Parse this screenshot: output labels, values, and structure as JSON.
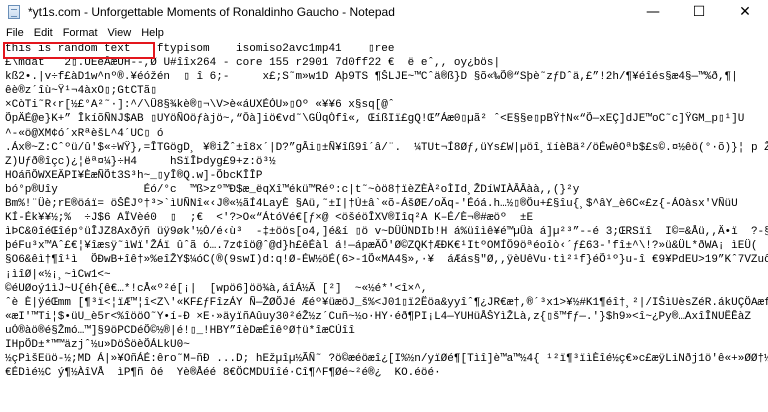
{
  "window": {
    "title": "*yt1s.com - Unforgettable Moments of Ronaldinho Gaucho - Notepad",
    "minimize_glyph": "—",
    "maximize_glyph": "☐",
    "close_glyph": "✕"
  },
  "menu": {
    "file": "File",
    "edit": "Edit",
    "format": "Format",
    "view": "View",
    "help": "Help"
  },
  "colors": {
    "highlight_box": "#e3161d"
  },
  "document": {
    "lines": [
      "this is random text    ftypisom    isomiso2avc1mp41    ▯ree",
      "£\\mdat   2▯.UEéÅæUH--,Ø U#îîx264 - core 155 r2901 7d0ff22 €  ë eˆ,, oy¿bös|",
      "kß2•.|v÷f£àD1w^nº®.¥éóžén  ▯ î 6;-     x£;S˜m»w1D Aþ9TS ¶ŠLJE~™Cˆä®ß}D §õ«‰Õ®“Sþè˜zƒDˆä,£”!2h/¶¥éîés§æ4§—™%ð,¶|",
      "êè®z´îù~Ÿ¹¬4àxO▯;GtCTã▯",
      "×CòTi˜R‹r[½£°A²˜·]:^/\\Û8§¾kè®▯¬\\V>è«áUXÉÓU»▯Oº «¥¥6 x§sq[@ˆ",
      "ÕpÄÉ@e}K+” ÎkíõÑNJ$AB ▯UYöÑOöƒàjö~,“Ôà]iö€vd˜\\GÜqÒfî«, ŒíßIï£gQ!Œ”Áæ0▯µã² ˆ<E§§e▯pBŸ†N«“Õ—xEÇ]dJE™oC˜c]ŸGM_p▯¹]U",
      "^-«ö@XM¢ó´xRªèšL^4´UC▯ ó",
      ".Áx®~Z:Cˆºü/û'$«÷WŸ},=ÎTGögD¸ ¥®iŽˆ±î8x´|D?”gÂi▯±Ñ¥îß9î´â/¨.  ¼TUt¬Í8Øƒ,üYs£W|µöî¸ïíèBä²/öÉwêOªb$£s©.¤½êö(°·õ)}¦ p Žéöè†®±é¹¿è¬1¦6KàØÿÿ]è>/",
      "Z)Uƒð®îçc)¿¦ëª¤¼}÷H4     hSïÎÞdyg£9+z:ö³½",
      "HOáñÔWXEÄPI¥ÈæÑÕt3S³h~_▯yÎ®Q.w]-ÕbcKÎÎP",
      "bó°p®Uîy             Éó/°c  ™ß>zº™Ð$æ_ëqXî™ékü™Réº:c|t˜~òö8†ïèZÈÀ²oÌId¸ŽDíWIÀÂÂàà,,(}²y",
      "Bm%!¨Üè;rE®öáï= öŠÊJº†³>`ìUÑNî«‹J®«½ãÍ4LayÈ §Aü,˜±I|†Ú±â`«õ-ÁšØE/oÄq-'Éóá.h…½▯®Öu+£§îu{¸$^âY_è6C«£z{-ÁOàsx'VÑüU",
      "KÍ-Ék¥¥½;%  ÷J$6 AÏVèé0  ▯  ;€  <'?>O«“ÁtóVé€[ƒ×@ <öšéöÎXV®Iîq²A K–É/È¬®#æöº  ±E",
      "ìÞC&0îéŒîép°üÎJZ8Axðýñ üÿ9øk'½Ò/é‹ù³  -‡±öös[o4,]é&í ▯ö v~DÜÜNDIb!H á%üîìê¥é™µÜà á]µ²³”--é 3;ŒRSïî  I©=&Åü,,Ä•ï  ?-§IèöÒy",
      "þéFu³x™Aˆ£€¦¥îæsÿ˜ìWï'ŽÁï ûˆã ó….7z¢îö@ˆ@d}h£êÉàl á!—ápæÄÕ'Ø©ZQK†ÆÐK€¹ItºOMÍÖ9öªéoîò‹´ƒ£63-'fî±^\\!?»ü&ÜL*ðWA¡ ìEÜ(  á",
      "§O6&êì†¶î¹ì  ÕÐwB+îê†»%eîŽY$¼óC(®(9swI)d:q!Ø-ÉW½öÉ(6>-1Õ«MA4§»,·¥  áÆás§\"Ø,,ÿèUêVu·tì²¹f}éÕ¹º}u-î €9¥PdEU>19”Kˆ7VZuô0Îî",
      "¡ìîØ|«½¡¸~ìCw1<~",
      "©éUØoý1ìJ~U{éh{ê€…*!cÅ«º²é[¡|  [wpö6]öö¾à,áîÁ½Ä [²]  ~«½é*'<î×^,",
      "ˆè È|ÿéŒmm [¶³ï<¦ïÆ™¦î<Z\\'«KF£ƒFîzÁY Ñ—ŽØÕJé Æéº¥üæöJ_š%<J01▯ï2Ëöa&yyîˆ¶¿JR€æ†,®´­³x1>¥½#K1¶éî†¸²|/IŠìUèsZéR.ákUÇÖAæfl-",
      "«æI'™Ti¦$•üU_è5r<%îööO˜Y•í-Ð ×E·»äyïñAûuy30²éŽ½z´Cuñ~½o·HY·éð¶PI¡L4—YUHüÅŠYìŽLà,z{▯š™fƒ—.'}$h9»<î~¿Py®…AxîÎNUËÊàZ",
      "uÓ®àö®é§Žmó…™]§9öPCDéÕ©½®|é!▯_!HBY”îèDæÉîêºØ†ü*îæCÚîî",
      "IHpÕD±*™™äzjˆ½u»DöŠöèÕÁLkU0~",
      "½çPìšEüö-½;MD Á|»¥OñÁÉ:êro˜M–ñÐ ...D; hEžµîµ½ÃÑ˜ ?ö©æéöæî¿[I%½n/yïØé¶[Tìî]è™a™½4{ ¹²ï¶³ïìÈîé½ç€»c£æÿLiNðj1ö'ê«+»ØØ†½ÉÈ±ðìö¬1+—",
      "€ÉDìé½C ý¶½ÀîVÅ  ìP¶ñ ôé  Yè®Åéé 8€ÖCMDUîîé·Cî¶^F¶Øé~²é®¿  KO.éöé·"
    ]
  }
}
